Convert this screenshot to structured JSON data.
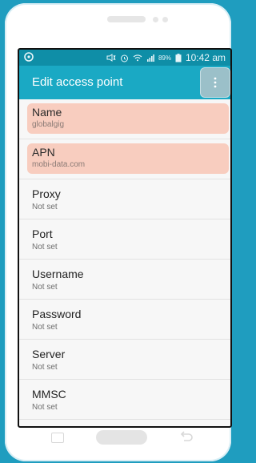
{
  "status_bar": {
    "battery": "89%",
    "time": "10:42 am"
  },
  "app_bar": {
    "title": "Edit access point"
  },
  "settings": [
    {
      "label": "Name",
      "value": "globalgig",
      "highlighted": true
    },
    {
      "label": "APN",
      "value": "mobi-data.com",
      "highlighted": true
    },
    {
      "label": "Proxy",
      "value": "Not set",
      "highlighted": false
    },
    {
      "label": "Port",
      "value": "Not set",
      "highlighted": false
    },
    {
      "label": "Username",
      "value": "Not set",
      "highlighted": false
    },
    {
      "label": "Password",
      "value": "Not set",
      "highlighted": false
    },
    {
      "label": "Server",
      "value": "Not set",
      "highlighted": false
    },
    {
      "label": "MMSC",
      "value": "Not set",
      "highlighted": false
    }
  ],
  "colors": {
    "background": "#1f9dbf",
    "status_bar": "#0f8ea7",
    "app_bar": "#1aa9c4",
    "highlight": "#f8cdbf"
  },
  "icons": {
    "menu": "overflow-menu-icon",
    "recent": "recent-apps-icon",
    "back": "back-icon"
  }
}
